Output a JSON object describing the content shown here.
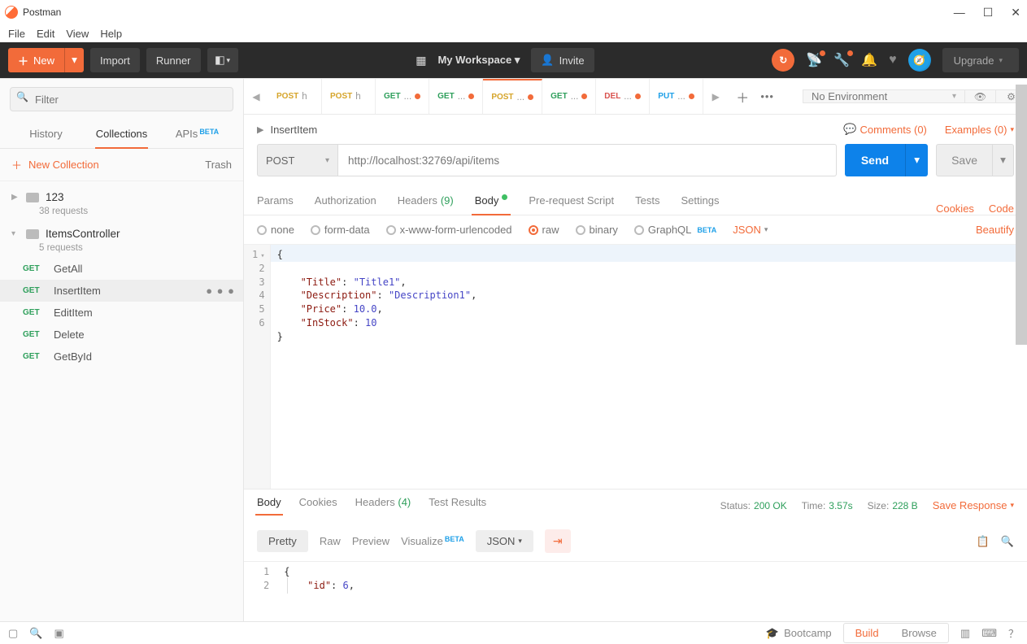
{
  "app": {
    "title": "Postman"
  },
  "menu": {
    "file": "File",
    "edit": "Edit",
    "view": "View",
    "help": "Help"
  },
  "toolbar": {
    "new": "New",
    "import": "Import",
    "runner": "Runner",
    "workspace": "My Workspace",
    "invite": "Invite",
    "upgrade": "Upgrade"
  },
  "sidebar": {
    "filter_placeholder": "Filter",
    "tabs": {
      "history": "History",
      "collections": "Collections",
      "apis": "APIs"
    },
    "beta": "BETA",
    "new_collection": "New Collection",
    "trash": "Trash",
    "folders": [
      {
        "name": "123",
        "sub": "38 requests",
        "expanded": false
      },
      {
        "name": "ItemsController",
        "sub": "5 requests",
        "expanded": true,
        "requests": [
          {
            "method": "GET",
            "name": "GetAll",
            "active": false
          },
          {
            "method": "GET",
            "name": "InsertItem",
            "active": true
          },
          {
            "method": "GET",
            "name": "EditItem",
            "active": false
          },
          {
            "method": "GET",
            "name": "Delete",
            "active": false
          },
          {
            "method": "GET",
            "name": "GetById",
            "active": false
          }
        ]
      }
    ]
  },
  "tabs": [
    {
      "method": "POST",
      "cls": "m-post",
      "label": "h",
      "dot": false,
      "active": false
    },
    {
      "method": "POST",
      "cls": "m-post",
      "label": "h",
      "dot": false,
      "active": false
    },
    {
      "method": "GET",
      "cls": "m-get",
      "label": "...",
      "dot": true,
      "active": false
    },
    {
      "method": "GET",
      "cls": "m-get",
      "label": "...",
      "dot": true,
      "active": false
    },
    {
      "method": "POST",
      "cls": "m-post",
      "label": "...",
      "dot": true,
      "active": true
    },
    {
      "method": "GET",
      "cls": "m-get",
      "label": "...",
      "dot": true,
      "active": false
    },
    {
      "method": "DEL",
      "cls": "m-del",
      "label": "...",
      "dot": true,
      "active": false
    },
    {
      "method": "PUT",
      "cls": "m-put",
      "label": "...",
      "dot": true,
      "active": false
    }
  ],
  "env": {
    "label": "No Environment"
  },
  "request": {
    "name": "InsertItem",
    "comments": "Comments (0)",
    "examples": "Examples (0)",
    "method": "POST",
    "url": "http://localhost:32769/api/items",
    "send": "Send",
    "save": "Save",
    "sub": {
      "params": "Params",
      "auth": "Authorization",
      "headers": "Headers",
      "headers_count": "(9)",
      "body": "Body",
      "prereq": "Pre-request Script",
      "tests": "Tests",
      "settings": "Settings",
      "cookies": "Cookies",
      "code": "Code"
    },
    "body_opts": {
      "none": "none",
      "form": "form-data",
      "urlenc": "x-www-form-urlencoded",
      "raw": "raw",
      "binary": "binary",
      "graphql": "GraphQL",
      "beta": "BETA",
      "type": "JSON",
      "beautify": "Beautify"
    },
    "body_code": {
      "l1": "{",
      "l2": "    \"Title\": \"Title1\",",
      "l3": "    \"Description\": \"Description1\",",
      "l4": "    \"Price\": 10.0,",
      "l5": "    \"InStock\": 10",
      "l6": "}"
    }
  },
  "response": {
    "tabs": {
      "body": "Body",
      "cookies": "Cookies",
      "headers": "Headers",
      "headers_count": "(4)",
      "tests": "Test Results"
    },
    "status_label": "Status:",
    "status": "200 OK",
    "time_label": "Time:",
    "time": "3.57s",
    "size_label": "Size:",
    "size": "228 B",
    "save": "Save Response",
    "toolbar": {
      "pretty": "Pretty",
      "raw": "Raw",
      "preview": "Preview",
      "visualize": "Visualize",
      "beta": "BETA",
      "type": "JSON"
    },
    "code": {
      "l1": "{",
      "l2": "    \"id\": 6,"
    }
  },
  "statusbar": {
    "bootcamp": "Bootcamp",
    "build": "Build",
    "browse": "Browse"
  }
}
